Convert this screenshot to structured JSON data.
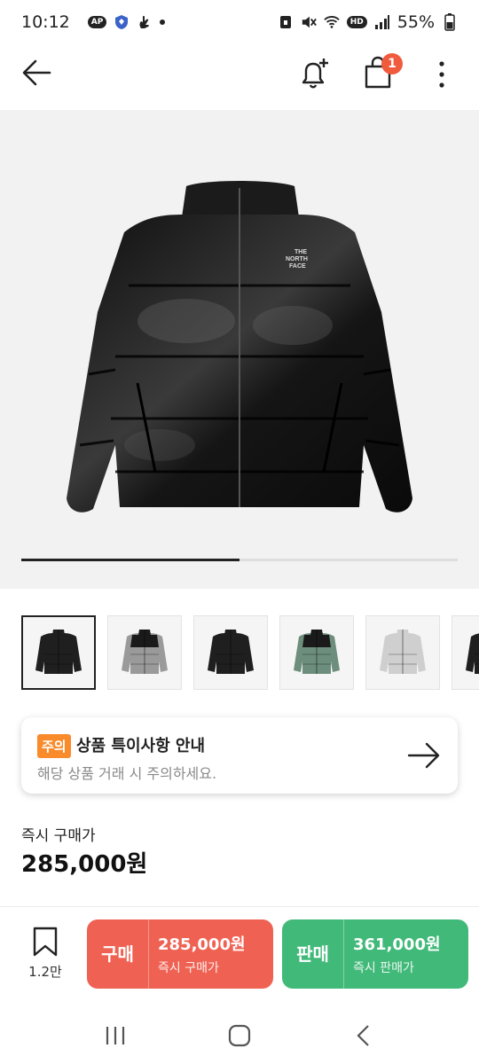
{
  "status": {
    "time": "10:12",
    "battery": "55%",
    "hd_label": "HD",
    "ap_label": "AP"
  },
  "topbar": {
    "cart_count": "1"
  },
  "gallery": {
    "progress": 0.5,
    "thumb_colors": [
      "#1f1f1f",
      "#9a9a9a",
      "#1f1f1f",
      "#6d8e7c",
      "#cfcfcf",
      "#1f1f1f"
    ],
    "brand_text": "THE NORTH FACE"
  },
  "notice": {
    "tag": "주의",
    "title": "상품 특이사항 안내",
    "description": "해당 상품 거래 시 주의하세요."
  },
  "price": {
    "label": "즉시 구매가",
    "value": "285,000원"
  },
  "actions": {
    "wish_count": "1.2만",
    "buy": {
      "label": "구매",
      "amount": "285,000원",
      "sub": "즉시 구매가",
      "color": "#ef6253"
    },
    "sell": {
      "label": "판매",
      "amount": "361,000원",
      "sub": "즉시 판매가",
      "color": "#41b979"
    }
  }
}
